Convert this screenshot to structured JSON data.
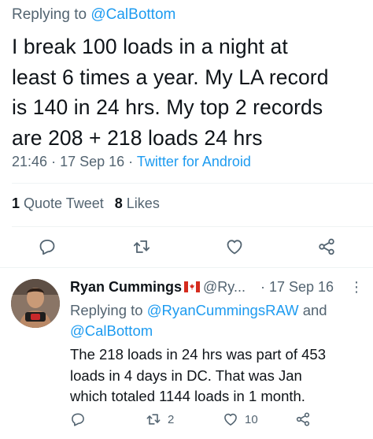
{
  "main_tweet": {
    "replying_prefix": "Replying to",
    "replying_mention": "@CalBottom",
    "text_lines": [
      "I break 100 loads in a night at",
      "least 6 times a year. My LA record",
      "is 140 in 24 hrs. My top 2 records",
      "are 208 + 218 loads 24 hrs"
    ],
    "time": "21:46",
    "date": "17 Sep 16",
    "source": "Twitter for Android",
    "quote_count": "1",
    "quote_label": "Quote Tweet",
    "like_count": "8",
    "like_label": "Likes"
  },
  "reply_tweet": {
    "name": "Ryan Cummings",
    "handle": "@Ry...",
    "date": "· 17 Sep 16",
    "more": "⋮",
    "replying_prefix": "Replying to",
    "replying_mention_1": "@RyanCummingsRAW",
    "replying_and": "and",
    "replying_mention_2": "@CalBottom",
    "text_lines": [
      "The 218 loads in 24 hrs was part of 453",
      "loads in 4 days in DC. That was Jan",
      "which totaled 1144 loads in 1 month."
    ],
    "retweet_count": "2",
    "like_count": "10"
  },
  "icons": {
    "reply": "reply-icon",
    "retweet": "retweet-icon",
    "like": "heart-icon",
    "share": "share-icon",
    "flag": "canada-flag-icon"
  },
  "colors": {
    "text": "#0f1419",
    "secondary": "#536471",
    "link": "#1d9bf0",
    "divider": "#eff3f4"
  }
}
